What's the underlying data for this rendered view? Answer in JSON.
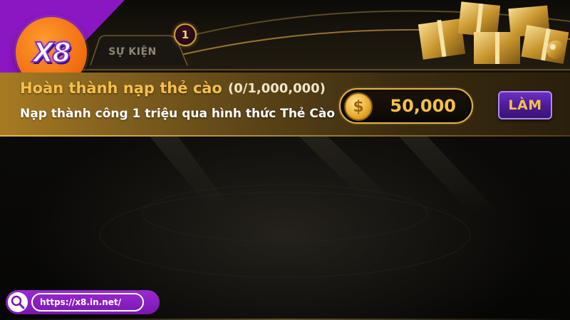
{
  "brand": {
    "logo_text": "X8",
    "url": "https://x8.in.net/"
  },
  "tabs": [
    {
      "label": "SỰ KIỆN",
      "badge": "1"
    }
  ],
  "mission": {
    "title": "Hoàn thành nạp thẻ cào",
    "progress": "(0/1,000,000)",
    "description": "Nạp thành công 1 triệu qua hình thức Thẻ Cào",
    "reward_value": "50,000",
    "action_label": "LÀM"
  },
  "colors": {
    "gold": "#f5c04a",
    "purple": "#7a16b4",
    "logo_orange": "#f06a10"
  },
  "icons": {
    "coin": "coin-icon",
    "search": "search-icon",
    "gifts": "gift-boxes-decoration"
  }
}
